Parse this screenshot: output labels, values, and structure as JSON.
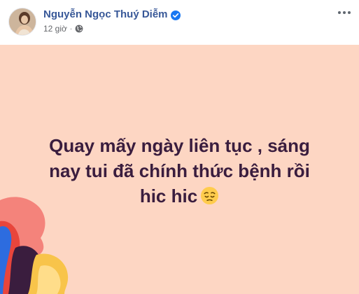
{
  "post": {
    "author_name": "Nguyễn Ngọc Thuý Diễm",
    "timestamp": "12 giờ",
    "separator": "·",
    "audience_icon": "globe-icon",
    "verified_icon": "verified-badge-icon",
    "more_icon": "more-options-icon",
    "text_line_1": "Quay mấy ngày liên tục , sáng",
    "text_line_2": "nay tui đã chính thức bệnh rồi",
    "text_line_3": "hic hic",
    "emoji_icon": "pensive-face-icon"
  },
  "colors": {
    "author": "#385898",
    "meta": "#65676b",
    "card_background": "#fdd6c3",
    "card_text": "#3a1d3e"
  }
}
